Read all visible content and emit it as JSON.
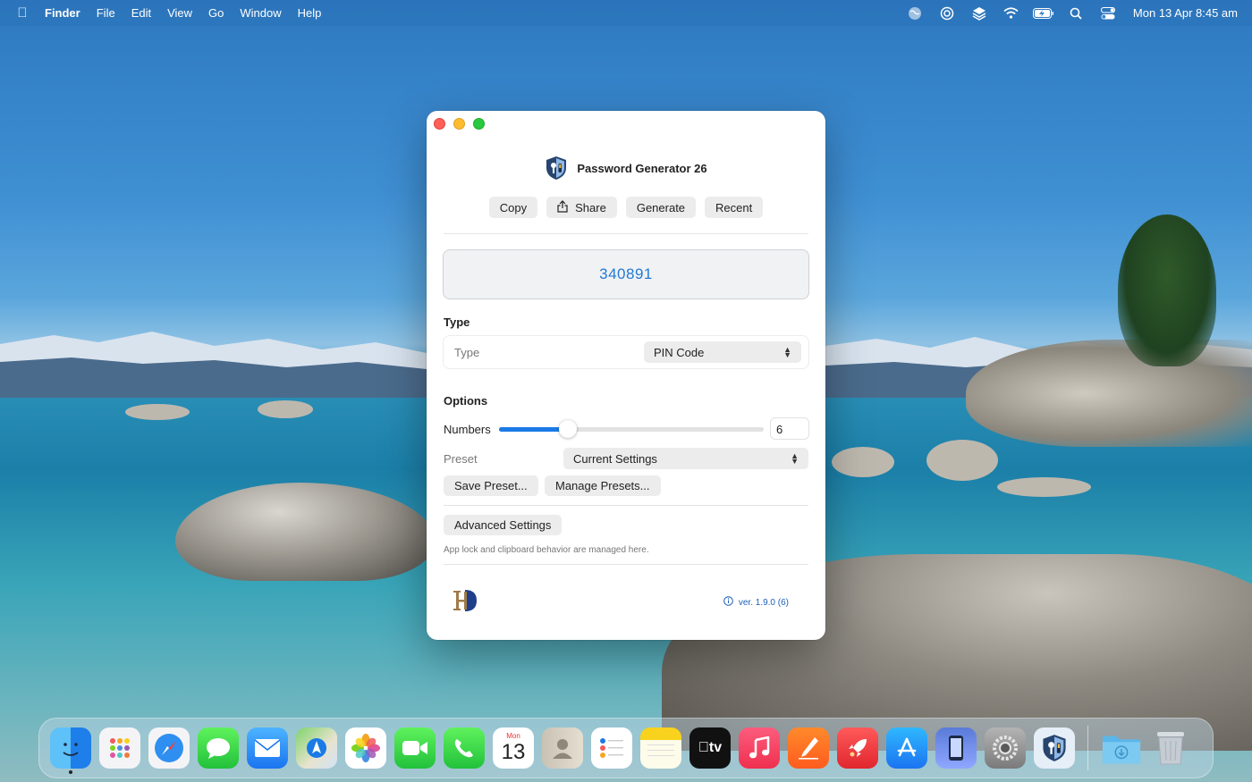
{
  "menubar": {
    "app_name": "Finder",
    "menus": [
      "File",
      "Edit",
      "View",
      "Go",
      "Window",
      "Help"
    ],
    "status_icons": [
      "globe-icon",
      "lifebuoy-icon",
      "layers-icon",
      "wifi-icon",
      "battery-charging-icon",
      "spotlight-search-icon",
      "control-center-icon"
    ],
    "clock": "Mon 13 Apr  8:45 am"
  },
  "window": {
    "title": "Password Generator 26",
    "toolbar": {
      "copy_label": "Copy",
      "share_label": "Share",
      "generate_label": "Generate",
      "recent_label": "Recent"
    },
    "generated_value": "340891",
    "type_section": {
      "heading": "Type",
      "field_label": "Type",
      "selected": "PIN Code"
    },
    "options_section": {
      "heading": "Options",
      "numbers_label": "Numbers",
      "numbers_value": "6",
      "numbers_slider_fraction": 0.26,
      "preset_label": "Preset",
      "preset_selected": "Current Settings",
      "save_preset_label": "Save Preset...",
      "manage_presets_label": "Manage Presets..."
    },
    "advanced": {
      "button_label": "Advanced Settings",
      "note": "App lock and clipboard behavior are managed here."
    },
    "footer": {
      "version": "ver. 1.9.0 (6)"
    }
  },
  "dock": {
    "apps": [
      "Finder",
      "Launchpad",
      "Safari",
      "Messages",
      "Mail",
      "Maps",
      "Photos",
      "FaceTime",
      "Phone",
      "Calendar",
      "Contacts",
      "Reminders",
      "Notes",
      "TV",
      "Music",
      "Pages",
      "Rocket",
      "App Store",
      "Simulator",
      "System Settings",
      "Password Generator"
    ],
    "calendar_day": "Mon",
    "calendar_date": "13",
    "tv_label": "tv",
    "after_divider": [
      "Downloads",
      "Trash"
    ]
  },
  "colors": {
    "accent": "#1a7ae6",
    "generated_text": "#1f7ad4",
    "close": "#fe5f57",
    "minimize": "#febc2e",
    "zoom": "#28c840"
  }
}
